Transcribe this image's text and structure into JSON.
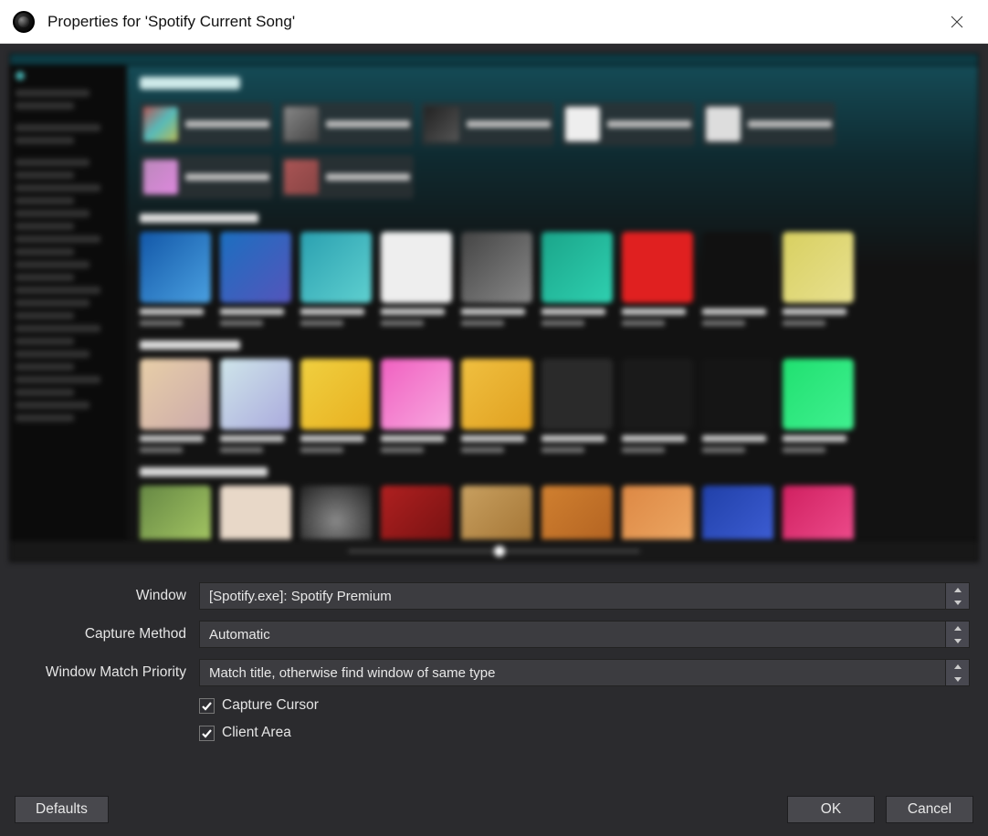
{
  "title": "Properties for 'Spotify Current Song'",
  "form": {
    "window_label": "Window",
    "window_value": "[Spotify.exe]: Spotify Premium",
    "capture_method_label": "Capture Method",
    "capture_method_value": "Automatic",
    "match_priority_label": "Window Match Priority",
    "match_priority_value": "Match title, otherwise find window of same type",
    "capture_cursor_label": "Capture Cursor",
    "capture_cursor_checked": true,
    "client_area_label": "Client Area",
    "client_area_checked": true
  },
  "buttons": {
    "defaults": "Defaults",
    "ok": "OK",
    "cancel": "Cancel"
  }
}
